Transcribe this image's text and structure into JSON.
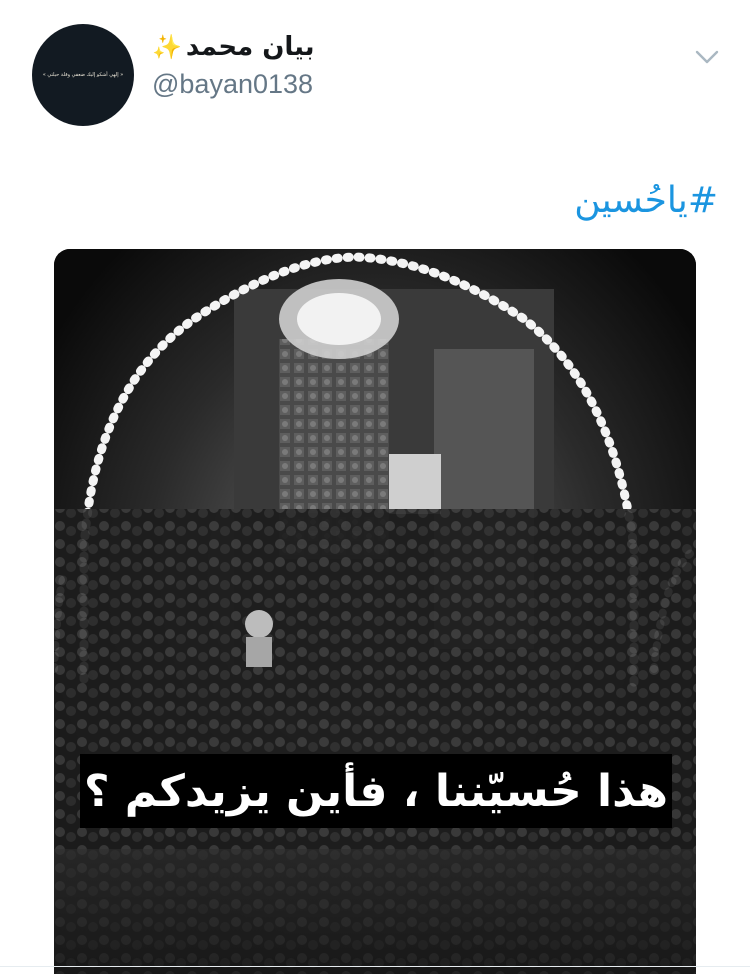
{
  "tweet": {
    "author": {
      "display_name": "بيان محمد",
      "emoji": "✨",
      "handle": "@bayan0138",
      "avatar_text": "« إلهي أشكو إليك ضعفي وقلة حيلتي »"
    },
    "text_hashtag": "#ياحُسين",
    "media": {
      "caption": "هذا حُسيّننا ، فأين يزيدكم ؟",
      "style": "black-and-white photo"
    }
  },
  "colors": {
    "link": "#1b95e0",
    "handle": "#657786",
    "name": "#14171a"
  },
  "icons": {
    "menu": "chevron-down-icon",
    "name_emoji": "sparkles-icon"
  }
}
